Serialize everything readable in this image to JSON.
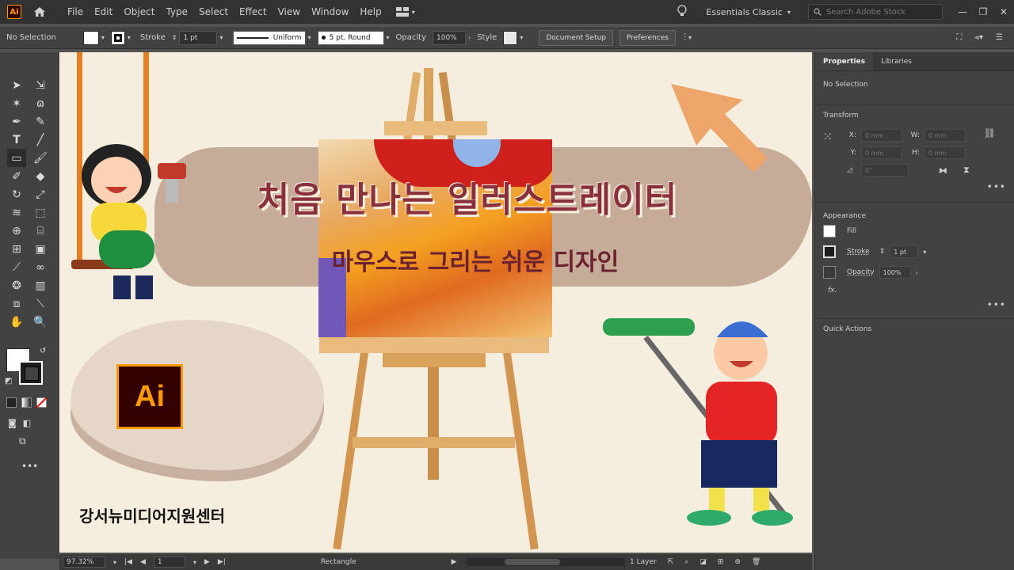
{
  "menubar": {
    "app_badge": "Ai",
    "items": [
      "File",
      "Edit",
      "Object",
      "Type",
      "Select",
      "Effect",
      "View",
      "Window",
      "Help"
    ],
    "workspace": "Essentials Classic",
    "search_placeholder": "Search Adobe Stock"
  },
  "controlbar": {
    "selection": "No Selection",
    "stroke_label": "Stroke",
    "stroke_value": "1 pt",
    "stroke_profile": "Uniform",
    "brush": "5 pt. Round",
    "opacity_label": "Opacity",
    "opacity_value": "100%",
    "style_label": "Style",
    "doc_setup": "Document Setup",
    "preferences": "Preferences"
  },
  "artwork": {
    "title": "처음 만나는 일러스트레이터",
    "subtitle": "마우스로 그리는 쉬운 디자인",
    "organization": "강서뉴미디어지원센터",
    "logo": "Ai"
  },
  "panel": {
    "tabs": [
      "Properties",
      "Libraries"
    ],
    "selection": "No Selection",
    "transform_title": "Transform",
    "x_label": "X:",
    "x_value": "0 mm",
    "y_label": "Y:",
    "y_value": "0 mm",
    "w_label": "W:",
    "w_value": "0 mm",
    "h_label": "H:",
    "h_value": "0 mm",
    "angle": "0°",
    "appearance_title": "Appearance",
    "fill_label": "Fill",
    "stroke_label": "Stroke",
    "stroke_value": "1 pt",
    "opacity_label": "Opacity",
    "opacity_value": "100%",
    "fx_label": "fx.",
    "quick_actions": "Quick Actions"
  },
  "statusbar": {
    "zoom": "97.32%",
    "artboard": "1",
    "tool": "Rectangle",
    "layers": "1 Layer"
  },
  "colors": {
    "accent": "#ff9a00",
    "title": "#8a2f3c",
    "canvas": "#f5eedf"
  }
}
